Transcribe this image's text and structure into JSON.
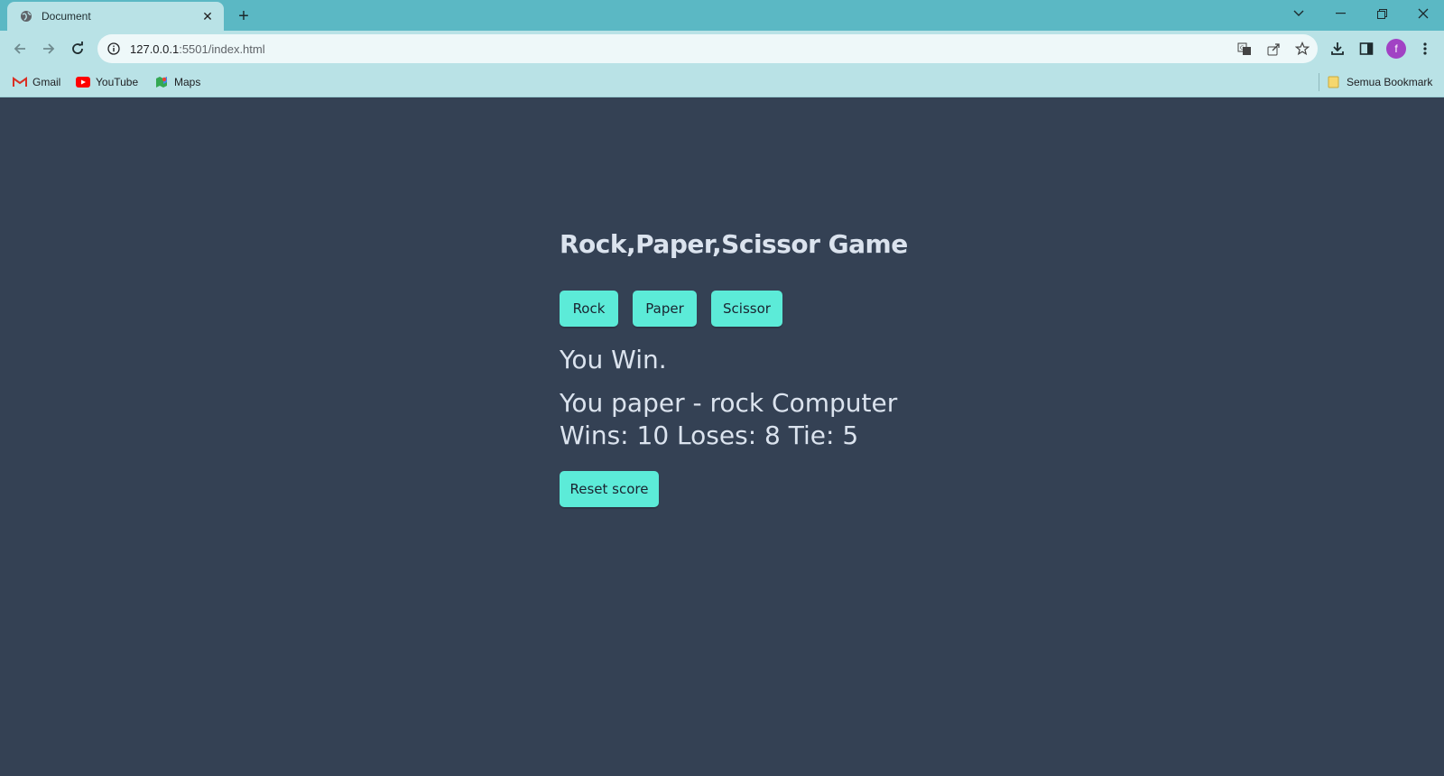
{
  "browser": {
    "tab_title": "Document",
    "url_host": "127.0.0.1",
    "url_rest": ":5501/index.html",
    "bookmarks": [
      {
        "label": "Gmail",
        "icon": "gmail-icon"
      },
      {
        "label": "YouTube",
        "icon": "youtube-icon"
      },
      {
        "label": "Maps",
        "icon": "maps-icon"
      }
    ],
    "all_bookmarks_label": "Semua Bookmark",
    "avatar_letter": "f",
    "accent_color": "#5bb8c4"
  },
  "game": {
    "title": "Rock,Paper,Scissor Game",
    "buttons": {
      "rock": "Rock",
      "paper": "Paper",
      "scissor": "Scissor",
      "reset": "Reset score"
    },
    "result": "You Win.",
    "moves": "You paper - rock Computer",
    "score": "Wins: 10 Loses: 8 Tie: 5",
    "button_color": "#5cebd8",
    "background_color": "#344154"
  }
}
